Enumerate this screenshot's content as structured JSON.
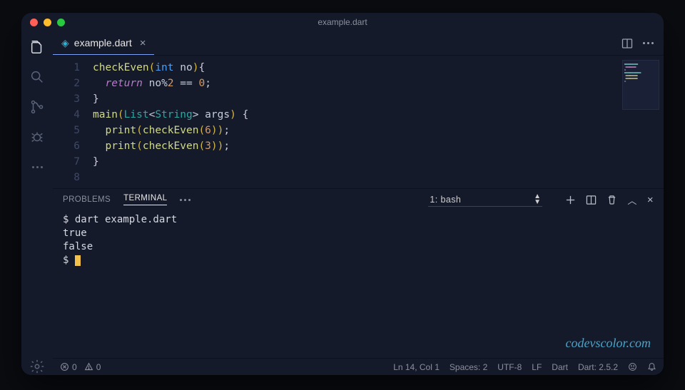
{
  "window": {
    "title": "example.dart"
  },
  "tab": {
    "filename": "example.dart"
  },
  "code": {
    "lines": [
      "1",
      "2",
      "3",
      "4",
      "5",
      "6",
      "7",
      "8"
    ]
  },
  "panel": {
    "tabs": {
      "problems": "PROBLEMS",
      "terminal": "TERMINAL"
    },
    "terminal_selector": "1: bash"
  },
  "terminal": {
    "line1": "$ dart example.dart",
    "line2": "true",
    "line3": "false",
    "prompt": "$ "
  },
  "status": {
    "errors": "0",
    "warnings": "0",
    "cursor": "Ln 14, Col 1",
    "spaces": "Spaces: 2",
    "encoding": "UTF-8",
    "eol": "LF",
    "lang": "Dart",
    "sdk": "Dart: 2.5.2"
  },
  "watermark": "codevscolor.com"
}
